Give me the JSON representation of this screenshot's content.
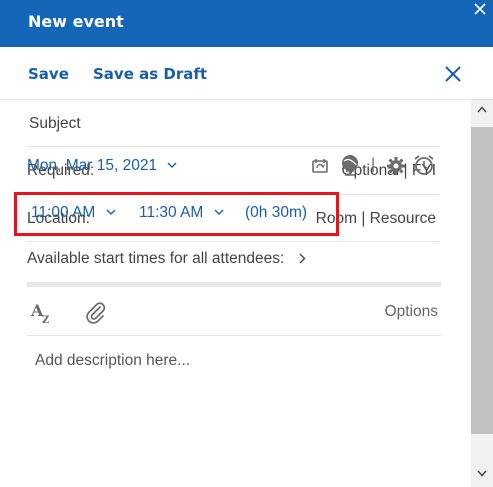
{
  "header": {
    "title": "New event"
  },
  "toolbar": {
    "save_label": "Save",
    "save_draft_label": "Save as Draft"
  },
  "form": {
    "subject_placeholder": "Subject",
    "required_label": "Required:",
    "optional_fyi": "Optional | FYI",
    "location_label": "Location:",
    "room_resource": "Room | Resource",
    "date": "Mon, Mar 15, 2021",
    "start_time": "11:00 AM",
    "end_time": "11:30 AM",
    "duration": "(0h 30m)",
    "available_times": "Available start times for all attendees:",
    "options_label": "Options",
    "description_placeholder": "Add description here..."
  },
  "colors": {
    "title_bar": "#1565b8",
    "link_blue": "#1a5ea8",
    "highlight_red": "#e4151f"
  },
  "icons": [
    "close-icon",
    "recurrence-icon",
    "time-zone-globe-icon",
    "settings-gear-icon",
    "reminder-alarm-icon",
    "format-text-icon",
    "attachment-paperclip-icon",
    "chevron-down-icon",
    "chevron-right-icon"
  ]
}
